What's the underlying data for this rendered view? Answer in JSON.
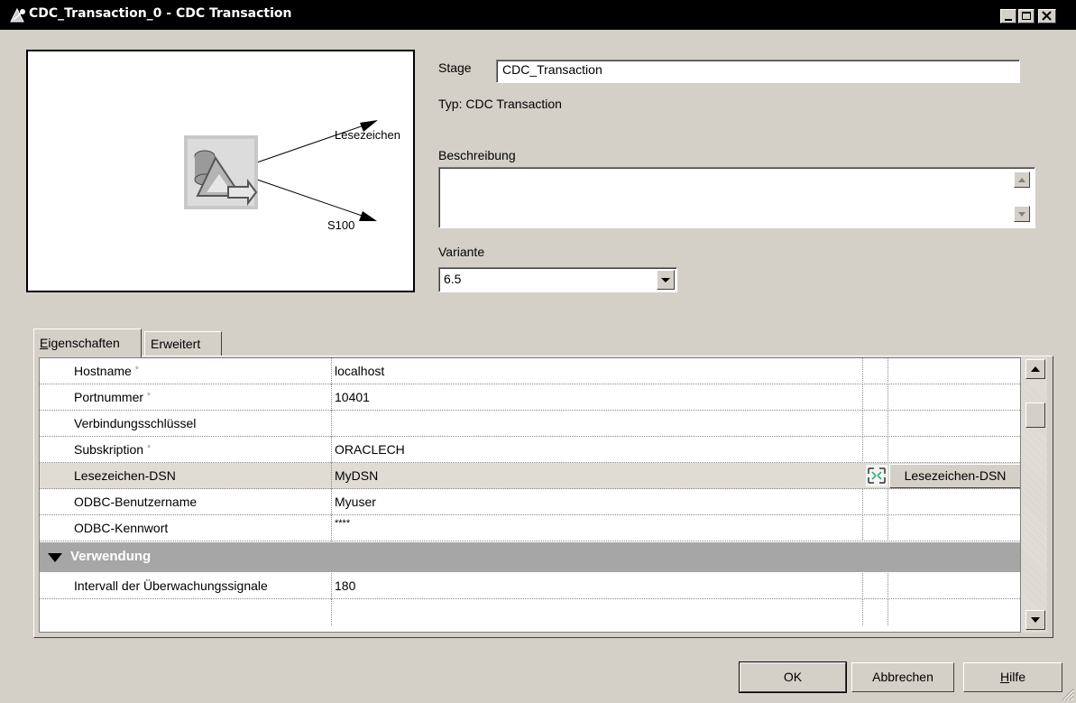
{
  "window": {
    "title": "CDC_Transaction_0 - CDC Transaction",
    "controls": [
      "minimize-icon",
      "maximize-icon",
      "close-icon"
    ]
  },
  "diagram": {
    "stage_icon": "cdc-transaction-stage-icon",
    "links": [
      "Lesezeichen",
      "S100"
    ]
  },
  "stage": {
    "label": "Stage",
    "value": "CDC_Transaction",
    "type_text": "Typ: CDC Transaction"
  },
  "description": {
    "label": "Beschreibung",
    "value": ""
  },
  "variant": {
    "label": "Variante",
    "value": "6.5"
  },
  "tabs": [
    {
      "label": "Eigenschaften",
      "mnemonic": "E",
      "active": true
    },
    {
      "label": "Erweitert",
      "mnemonic": "w",
      "active": false
    }
  ],
  "properties": [
    {
      "name": "Hostname",
      "required": true,
      "value": "localhost"
    },
    {
      "name": "Portnummer",
      "required": true,
      "value": "10401"
    },
    {
      "name": "Verbindungsschlüssel",
      "required": false,
      "value": ""
    },
    {
      "name": "Subskription",
      "required": true,
      "value": "ORACLECH"
    },
    {
      "name": "Lesezeichen-DSN",
      "required": false,
      "value": "MyDSN",
      "selected": true,
      "button_label": "Lesezeichen-DSN"
    },
    {
      "name": "ODBC-Benutzername",
      "required": false,
      "value": "Myuser"
    },
    {
      "name": "ODBC-Kennwort",
      "required": false,
      "value": "****"
    }
  ],
  "required_marker": "*",
  "section": {
    "title": "Verwendung",
    "properties": [
      {
        "name": "Intervall der Überwachungssignale",
        "value": "180"
      }
    ]
  },
  "buttons": {
    "ok": "OK",
    "cancel": "Abbrechen",
    "help": "Hilfe"
  },
  "colors": {
    "titlebar": "#000000",
    "dialog": "#d4d0c8",
    "section_header": "#a6a6a6",
    "selected_row": "#e0dcd4"
  }
}
